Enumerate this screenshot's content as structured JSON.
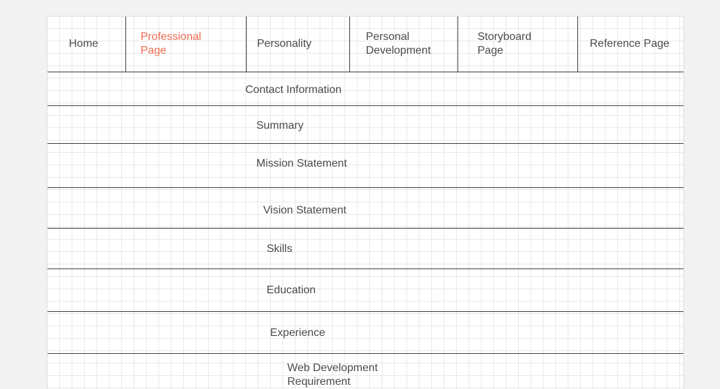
{
  "nav": {
    "home": "Home",
    "professional_line1": "Professional",
    "professional_line2": "Page",
    "personality": "Personality",
    "personal_dev_line1": "Personal",
    "personal_dev_line2": "Development",
    "storyboard_line1": "Storyboard",
    "storyboard_line2": "Page",
    "reference": "Reference Page",
    "active_item": "Professional Page",
    "active_color": "#ee6a4d"
  },
  "sections": {
    "contact": "Contact Information",
    "summary": "Summary",
    "mission": "Mission Statement",
    "vision": "Vision Statement",
    "skills": "Skills",
    "education": "Education",
    "experience": "Experience",
    "webdev_line1": "Web Development",
    "webdev_line2": "Requirement"
  },
  "colors": {
    "background": "#f2f2f2",
    "canvas": "#ffffff",
    "grid": "#e8e8e8",
    "lines": "#3c3c3c",
    "text": "#4a4a4a"
  }
}
